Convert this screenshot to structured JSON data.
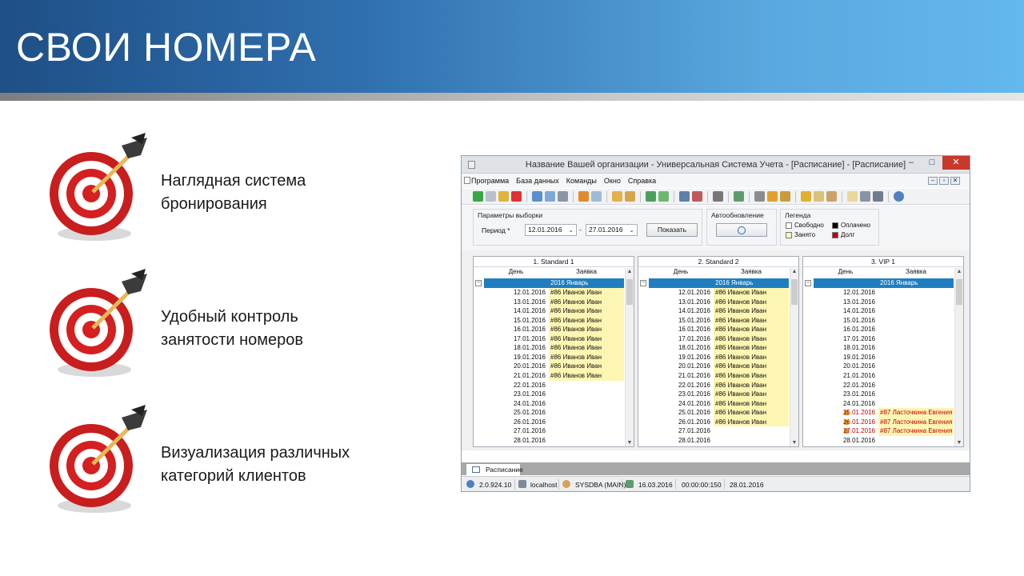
{
  "slide": {
    "title": "СВОИ НОМЕРА",
    "features": [
      {
        "text": "Наглядная система\nбронирования"
      },
      {
        "text": "Удобный контроль\nзанятости номеров"
      },
      {
        "text": "Визуализация различных\nкатегорий клиентов"
      }
    ]
  },
  "window": {
    "title": "Название Вашей организации - Универсальная Система Учета - [Расписание] - [Расписание]",
    "controls": {
      "minimize": "–",
      "maximize": "□",
      "close": "✕"
    },
    "menu": [
      "Программа",
      "База данных",
      "Команды",
      "Окно",
      "Справка"
    ],
    "mdi_controls": {
      "minimize": "–",
      "restore": "▫",
      "close": "✕"
    },
    "params": {
      "group_label": "Параметры выборки",
      "period_label": "Период *",
      "date_from": "12.01.2016",
      "date_sep": "-",
      "date_to": "27.01.2016",
      "show_button": "Показать",
      "auto_label": "Автообновление",
      "legend_label": "Легенда",
      "legend_free": "Свободно",
      "legend_busy": "Занято",
      "legend_paid": "Оплачено",
      "legend_debt": "Долг"
    },
    "colors": {
      "year_row": "#1f7ec0",
      "booked_fill": "#fdf6b2",
      "paid_text": "#c00000",
      "debt": "#c00000",
      "paid": "#000000"
    },
    "panes": [
      {
        "title": "1. Standard 1",
        "col_day": "День",
        "col_booking": "Заявка",
        "year_row": "2016 Январь",
        "rows": [
          {
            "day": "12.01.2016",
            "booking": "#86 Иванов Иван"
          },
          {
            "day": "13.01.2016",
            "booking": "#86 Иванов Иван"
          },
          {
            "day": "14.01.2016",
            "booking": "#86 Иванов Иван"
          },
          {
            "day": "15.01.2016",
            "booking": "#86 Иванов Иван"
          },
          {
            "day": "16.01.2016",
            "booking": "#86 Иванов Иван"
          },
          {
            "day": "17.01.2016",
            "booking": "#86 Иванов Иван"
          },
          {
            "day": "18.01.2016",
            "booking": "#86 Иванов Иван"
          },
          {
            "day": "19.01.2016",
            "booking": "#86 Иванов Иван"
          },
          {
            "day": "20.01.2016",
            "booking": "#86 Иванов Иван"
          },
          {
            "day": "21.01.2016",
            "booking": "#86 Иванов Иван"
          },
          {
            "day": "22.01.2016",
            "booking": ""
          },
          {
            "day": "23.01.2016",
            "booking": ""
          },
          {
            "day": "24.01.2016",
            "booking": ""
          },
          {
            "day": "25.01.2016",
            "booking": ""
          },
          {
            "day": "26.01.2016",
            "booking": ""
          },
          {
            "day": "27.01.2016",
            "booking": ""
          },
          {
            "day": "28.01.2016",
            "booking": ""
          }
        ]
      },
      {
        "title": "2. Standard 2",
        "col_day": "День",
        "col_booking": "Заявка",
        "year_row": "2016 Январь",
        "rows": [
          {
            "day": "12.01.2016",
            "booking": "#86 Иванов Иван"
          },
          {
            "day": "13.01.2016",
            "booking": "#86 Иванов Иван"
          },
          {
            "day": "14.01.2016",
            "booking": "#86 Иванов Иван"
          },
          {
            "day": "15.01.2016",
            "booking": "#86 Иванов Иван"
          },
          {
            "day": "16.01.2016",
            "booking": "#86 Иванов Иван"
          },
          {
            "day": "17.01.2016",
            "booking": "#86 Иванов Иван"
          },
          {
            "day": "18.01.2016",
            "booking": "#86 Иванов Иван"
          },
          {
            "day": "19.01.2016",
            "booking": "#86 Иванов Иван"
          },
          {
            "day": "20.01.2016",
            "booking": "#86 Иванов Иван"
          },
          {
            "day": "21.01.2016",
            "booking": "#86 Иванов Иван"
          },
          {
            "day": "22.01.2016",
            "booking": "#86 Иванов Иван"
          },
          {
            "day": "23.01.2016",
            "booking": "#86 Иванов Иван"
          },
          {
            "day": "24.01.2016",
            "booking": "#86 Иванов Иван"
          },
          {
            "day": "25.01.2016",
            "booking": "#86 Иванов Иван"
          },
          {
            "day": "26.01.2016",
            "booking": "#86 Иванов Иван"
          },
          {
            "day": "27.01.2016",
            "booking": ""
          },
          {
            "day": "28.01.2016",
            "booking": ""
          }
        ]
      },
      {
        "title": "3. VIP 1",
        "col_day": "День",
        "col_booking": "Заявка",
        "year_row": "2016 Январь",
        "rows": [
          {
            "day": "12.01.2016",
            "booking": ""
          },
          {
            "day": "13.01.2016",
            "booking": ""
          },
          {
            "day": "14.01.2016",
            "booking": ""
          },
          {
            "day": "15.01.2016",
            "booking": ""
          },
          {
            "day": "16.01.2016",
            "booking": ""
          },
          {
            "day": "17.01.2016",
            "booking": ""
          },
          {
            "day": "18.01.2016",
            "booking": ""
          },
          {
            "day": "19.01.2016",
            "booking": ""
          },
          {
            "day": "20.01.2016",
            "booking": ""
          },
          {
            "day": "21.01.2016",
            "booking": ""
          },
          {
            "day": "22.01.2016",
            "booking": ""
          },
          {
            "day": "23.01.2016",
            "booking": ""
          },
          {
            "day": "24.01.2016",
            "booking": ""
          },
          {
            "day": "25.01.2016",
            "booking": "#87 Ласточкина Евгения",
            "paid": true
          },
          {
            "day": "26.01.2016",
            "booking": "#87 Ласточкина Евгения",
            "paid": true
          },
          {
            "day": "27.01.2016",
            "booking": "#87 Ласточкина Евгения",
            "paid": true
          },
          {
            "day": "28.01.2016",
            "booking": ""
          }
        ]
      }
    ],
    "tab": "Расписание",
    "status": {
      "version": "2.0.924.10",
      "host": "localhost",
      "user": "SYSDBA (MAIN)",
      "date": "16.03.2016",
      "time": "00:00:00:150",
      "date2": "28.01.2016"
    }
  }
}
